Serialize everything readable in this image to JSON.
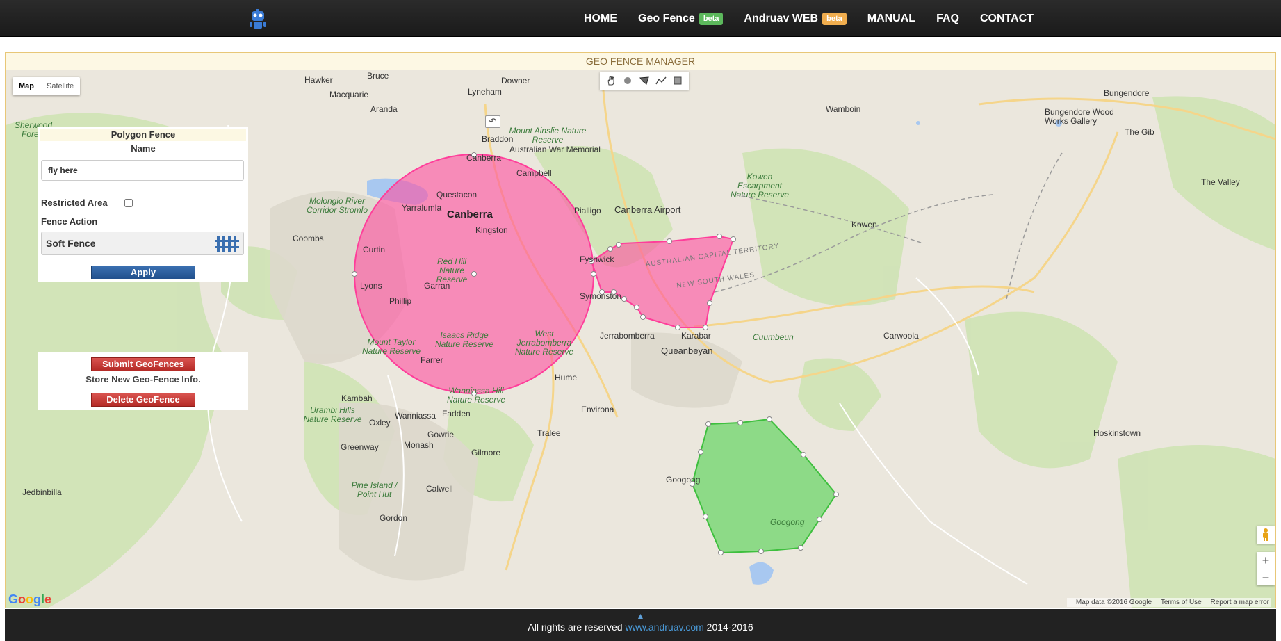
{
  "nav": {
    "logo": "robot-logo-icon",
    "items": [
      {
        "label": "HOME"
      },
      {
        "label": "Geo Fence",
        "badge": "beta",
        "badge_color": "#5cb85c"
      },
      {
        "label": "Andruav WEB",
        "badge": "beta",
        "badge_color": "#f0ad4e"
      },
      {
        "label": "MANUAL"
      },
      {
        "label": "FAQ"
      },
      {
        "label": "CONTACT"
      }
    ]
  },
  "panel": {
    "title": "GEO FENCE MANAGER"
  },
  "map": {
    "maptypes": [
      "Map",
      "Satellite"
    ],
    "active_maptype": "Map",
    "drawtools": [
      "hand-icon",
      "circle-icon",
      "polygon-icon",
      "polyline-icon",
      "rectangle-icon"
    ],
    "places": {
      "canberra": "Canberra",
      "canberra_airport": "Canberra Airport",
      "queanbeyan": "Queanbeyan",
      "bungendore": "Bungendore",
      "hawker": "Hawker",
      "macquarie": "Macquarie",
      "aranda": "Aranda",
      "bruce": "Bruce",
      "lyneham": "Lyneham",
      "downer": "Downer",
      "braddon": "Braddon",
      "campbell": "Campbell",
      "questacon": "Questacon",
      "yarralumla": "Yarralumla",
      "kingston": "Kingston",
      "curtin": "Curtin",
      "fyshwick": "Fyshwick",
      "pialligo": "Pialligo",
      "lyons": "Lyons",
      "garran": "Garran",
      "phillip": "Phillip",
      "symonston": "Symonston",
      "coombs": "Coombs",
      "farrer": "Farrer",
      "hume": "Hume",
      "kambah": "Kambah",
      "wanniassa": "Wanniassa",
      "fadden": "Fadden",
      "oxley": "Oxley",
      "gowrie": "Gowrie",
      "greenway": "Greenway",
      "monash": "Monash",
      "gilmore": "Gilmore",
      "calwell": "Calwell",
      "gordon": "Gordon",
      "tralee": "Tralee",
      "environa": "Environa",
      "jerrabomberra": "Jerrabomberra",
      "karabar": "Karabar",
      "googong": "Googong",
      "googong2": "Googong",
      "cuumbeun": "Cuumbeun",
      "carwoola": "Carwoola",
      "kowen": "Kowen",
      "wamboin": "Wamboin",
      "the_gib": "The Gib",
      "the_valley": "The Valley",
      "hoskinstown": "Hoskinstown",
      "jedbinbilla": "Jedbinbilla",
      "sherwood_forest": "Sherwood Forest",
      "bungendore_wood": "Bungendore Wood Works Gallery",
      "mount_ainslie": "Mount Ainslie Nature Reserve",
      "war_memorial": "Australian War Memorial",
      "red_hill": "Red Hill Nature Reserve",
      "isaacs": "Isaacs Ridge Nature Reserve",
      "west_jerra": "West Jerrabomberra Nature Reserve",
      "mount_taylor": "Mount Taylor Nature Reserve",
      "wanniassa_hill": "Wanniassa Hill Nature Reserve",
      "urambi": "Urambi Hills Nature Reserve",
      "pine_island": "Pine Island / Point Hut",
      "molonglo": "Molonglo River Corridor Stromlo",
      "kowen_esc": "Kowen Escarpment Nature Reserve",
      "act": "AUSTRALIAN CAPITAL TERRITORY",
      "nsw": "NEW SOUTH WALES"
    },
    "fences": [
      {
        "type": "circle",
        "color": "#ff4fa0"
      },
      {
        "type": "polygon",
        "color": "#ff4fa0"
      },
      {
        "type": "polygon",
        "color": "#4fd24f"
      }
    ],
    "attribution": {
      "data": "Map data ©2016 Google",
      "terms": "Terms of Use",
      "report": "Report a map error"
    },
    "google": "Google"
  },
  "form": {
    "title": "Polygon Fence",
    "name_label": "Name",
    "name_value": "fly here",
    "restricted_label": "Restricted Area",
    "restricted_checked": false,
    "action_label": "Fence Action",
    "action_value": "Soft Fence",
    "apply": "Apply"
  },
  "submit": {
    "submit_label": "Submit GeoFences",
    "info": "Store New Geo-Fence Info.",
    "delete_label": "Delete GeoFence"
  },
  "footer": {
    "prefix": "All rights are reserved",
    "link": "www.andruav.com",
    "years": "2014-2016"
  }
}
